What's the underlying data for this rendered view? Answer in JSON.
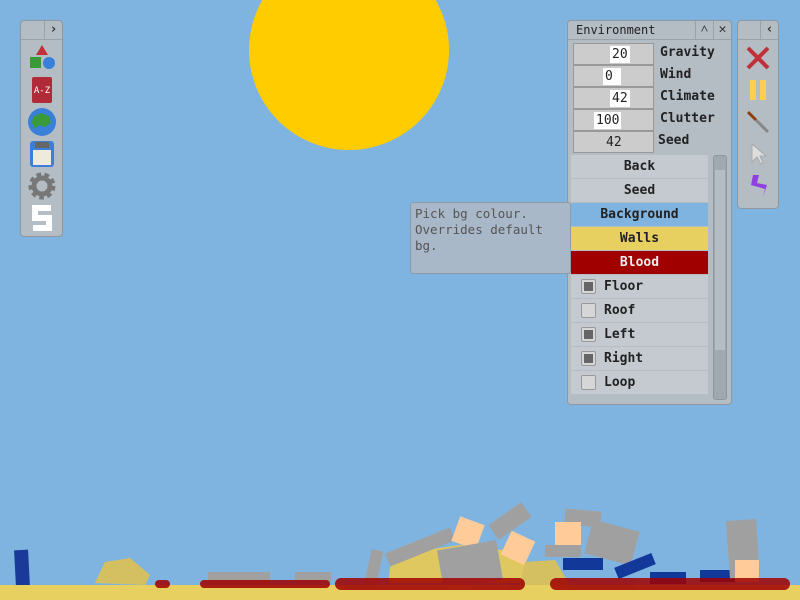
{
  "environment": {
    "title": "Environment",
    "fields": [
      {
        "label": "Gravity",
        "value": "20"
      },
      {
        "label": "Wind",
        "value": "0"
      },
      {
        "label": "Climate",
        "value": "42"
      },
      {
        "label": "Clutter",
        "value": "100"
      },
      {
        "label": "Seed",
        "value": "42"
      }
    ],
    "menu": [
      {
        "label": "Back"
      },
      {
        "label": "Seed"
      },
      {
        "label": "Background",
        "color": "#80b4e0"
      },
      {
        "label": "Walls",
        "color": "#e8d060"
      },
      {
        "label": "Blood",
        "color": "#a00000"
      }
    ],
    "toggles": [
      {
        "label": "Floor",
        "checked": true
      },
      {
        "label": "Roof",
        "checked": false
      },
      {
        "label": "Left",
        "checked": true
      },
      {
        "label": "Right",
        "checked": true
      },
      {
        "label": "Loop",
        "checked": false
      }
    ]
  },
  "tooltip": "Pick bg colour.\nOverrides default\nbg.",
  "left_toolbar": [
    "shapes-icon",
    "dictionary-icon",
    "globe-icon",
    "save-icon",
    "gear-icon",
    "s-logo-icon"
  ],
  "right_toolbar": [
    "clear-icon",
    "pause-icon",
    "knife-icon",
    "cursor-icon",
    "lightning-icon"
  ],
  "colors": {
    "sky": "#80b4e0",
    "sun": "#ffcc00",
    "ground": "#e8d060",
    "blood": "#a00000"
  }
}
